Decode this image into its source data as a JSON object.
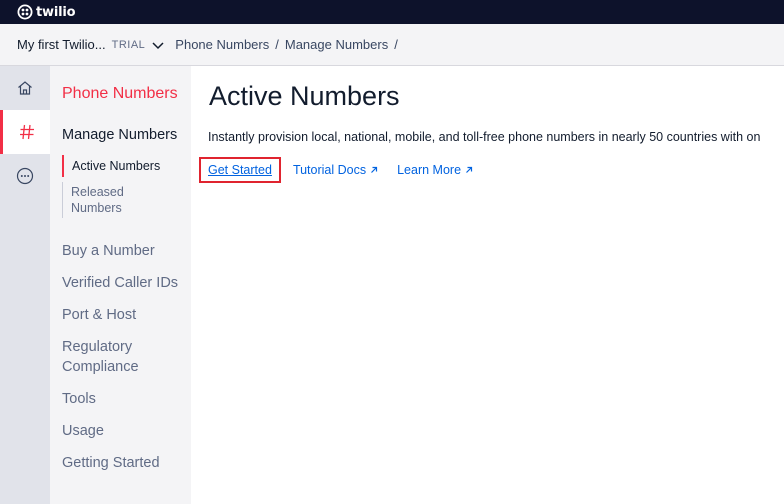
{
  "topbar": {
    "brand": "twilio"
  },
  "breadcrumb": {
    "account": "My first Twilio...",
    "badge": "TRIAL",
    "items": [
      "Phone Numbers",
      "Manage Numbers"
    ],
    "separator": "/"
  },
  "rail": {
    "items": [
      {
        "icon": "home-icon"
      },
      {
        "icon": "hash-icon",
        "active": true
      },
      {
        "icon": "more-icon"
      }
    ]
  },
  "sidenav": {
    "title": "Phone Numbers",
    "group": "Manage Numbers",
    "subitems": [
      "Active Numbers",
      "Released Numbers"
    ],
    "items": [
      "Buy a Number",
      "Verified Caller IDs",
      "Port & Host",
      "Regulatory Compliance",
      "Tools",
      "Usage",
      "Getting Started"
    ]
  },
  "main": {
    "title": "Active Numbers",
    "description": "Instantly provision local, national, mobile, and toll-free phone numbers in nearly 50 countries with on",
    "links": [
      "Get Started",
      "Tutorial Docs",
      "Learn More"
    ]
  },
  "colors": {
    "accent": "#f22f46",
    "link": "#0263e0",
    "topbar": "#0d122b",
    "highlight": "#e0242f"
  }
}
